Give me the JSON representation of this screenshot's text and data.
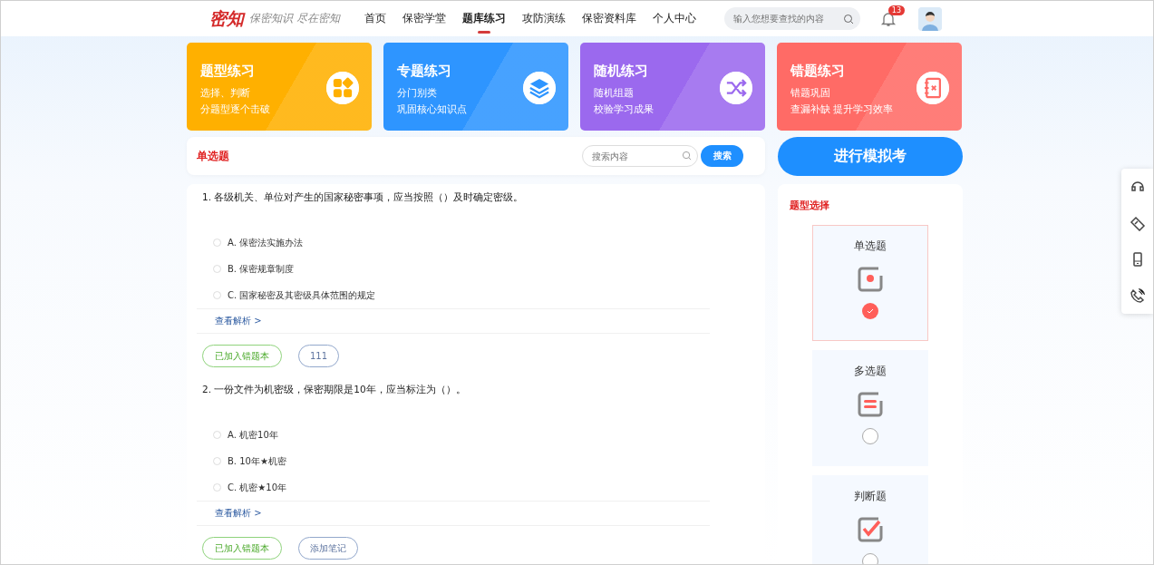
{
  "header": {
    "logo": "密知",
    "slogan": "保密知识 尽在密知",
    "nav": [
      {
        "label": "首页",
        "selected": false
      },
      {
        "label": "保密学堂",
        "selected": false
      },
      {
        "label": "题库练习",
        "selected": true
      },
      {
        "label": "攻防演练",
        "selected": false
      },
      {
        "label": "保密资料库",
        "selected": false
      },
      {
        "label": "个人中心",
        "selected": false
      }
    ],
    "search": {
      "placeholder": "输入您想要查找的内容"
    },
    "notifications": "13"
  },
  "modes": [
    {
      "kind": "type",
      "title": "题型练习",
      "lines": [
        "选择、判断",
        "分题型逐个击破"
      ],
      "color": "#ffb000"
    },
    {
      "kind": "topic",
      "title": "专题练习",
      "lines": [
        "分门别类",
        "巩固核心知识点"
      ],
      "color": "#2e95ff"
    },
    {
      "kind": "random",
      "title": "随机练习",
      "lines": [
        "随机组题",
        "校验学习成果"
      ],
      "color": "#9b69ee"
    },
    {
      "kind": "wrong",
      "title": "错题练习",
      "lines": [
        "错题巩固",
        "查漏补缺 提升学习效率"
      ],
      "color": "#ff6b66"
    }
  ],
  "list": {
    "title": "单选题",
    "search": {
      "placeholder": "搜索内容",
      "button": "搜索"
    },
    "questions": [
      {
        "text": "1. 各级机关、单位对产生的国家秘密事项，应当按照（）及时确定密级。",
        "options": [
          {
            "label": "A. 保密法实施办法",
            "selected": false
          },
          {
            "label": "B. 保密规章制度",
            "selected": false
          },
          {
            "label": "C. 国家秘密及其密级具体范围的规定",
            "selected": false
          }
        ],
        "analysis": "查看解析 >",
        "wrongbook": "已加入错题本",
        "note": "111"
      },
      {
        "text": "2. 一份文件为机密级，保密期限是10年，应当标注为（）。",
        "options": [
          {
            "label": "A. 机密10年",
            "selected": false
          },
          {
            "label": "B. 10年★机密",
            "selected": false
          },
          {
            "label": "C. 机密★10年",
            "selected": false
          }
        ],
        "analysis": "查看解析 >",
        "wrongbook": "已加入错题本",
        "note": "添加笔记"
      }
    ]
  },
  "exam_button": "进行模拟考",
  "type_select": {
    "title": "题型选择",
    "types": [
      {
        "kind": "single",
        "label": "单选题",
        "selected": true
      },
      {
        "kind": "multi",
        "label": "多选题",
        "selected": false
      },
      {
        "kind": "judge",
        "label": "判断题",
        "selected": false
      }
    ]
  }
}
